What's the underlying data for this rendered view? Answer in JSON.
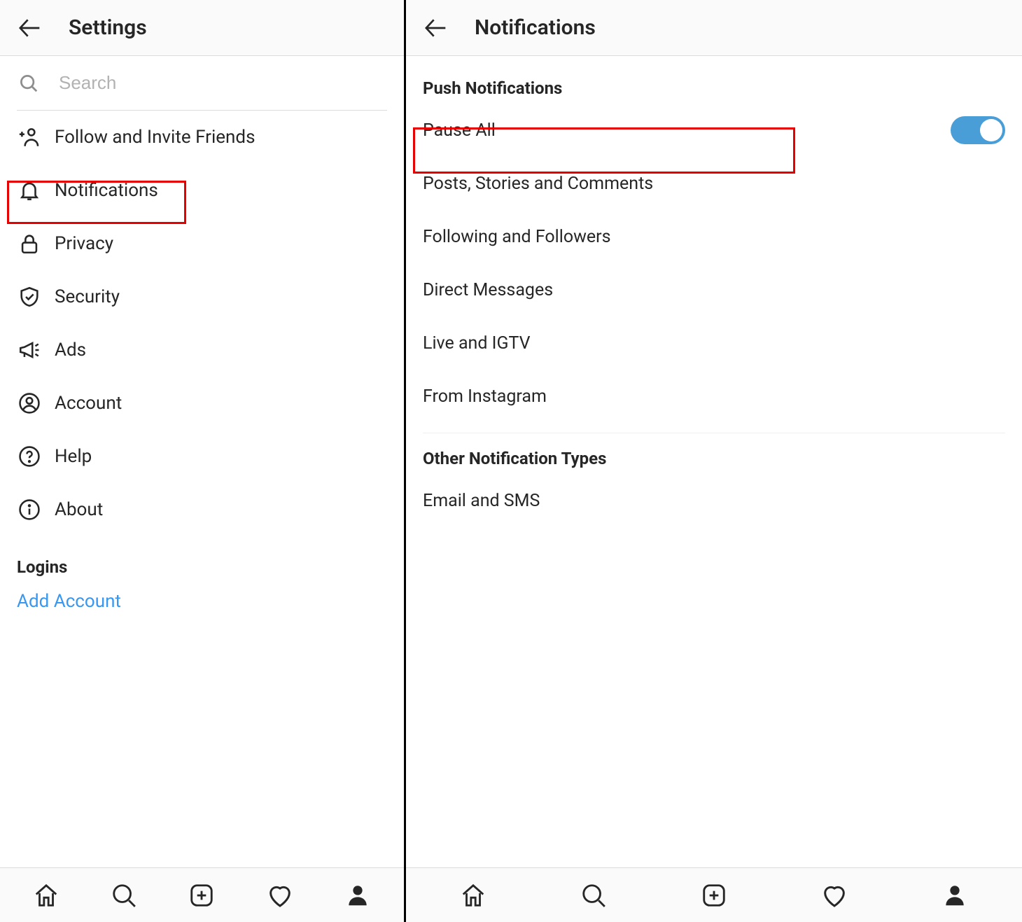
{
  "left": {
    "header_title": "Settings",
    "search_placeholder": "Search",
    "menu": [
      {
        "key": "follow-invite",
        "label": "Follow and Invite Friends"
      },
      {
        "key": "notifications",
        "label": "Notifications"
      },
      {
        "key": "privacy",
        "label": "Privacy"
      },
      {
        "key": "security",
        "label": "Security"
      },
      {
        "key": "ads",
        "label": "Ads"
      },
      {
        "key": "account",
        "label": "Account"
      },
      {
        "key": "help",
        "label": "Help"
      },
      {
        "key": "about",
        "label": "About"
      }
    ],
    "logins_heading": "Logins",
    "add_account_label": "Add Account"
  },
  "right": {
    "header_title": "Notifications",
    "push_section_heading": "Push Notifications",
    "pause_all_label": "Pause All",
    "pause_all_on": true,
    "push_items": [
      "Posts, Stories and Comments",
      "Following and Followers",
      "Direct Messages",
      "Live and IGTV",
      "From Instagram"
    ],
    "other_section_heading": "Other Notification Types",
    "other_items": [
      "Email and SMS"
    ]
  },
  "colors": {
    "accent": "#3897f0",
    "toggle_on": "#4a9ed8",
    "highlight": "#e60000"
  }
}
